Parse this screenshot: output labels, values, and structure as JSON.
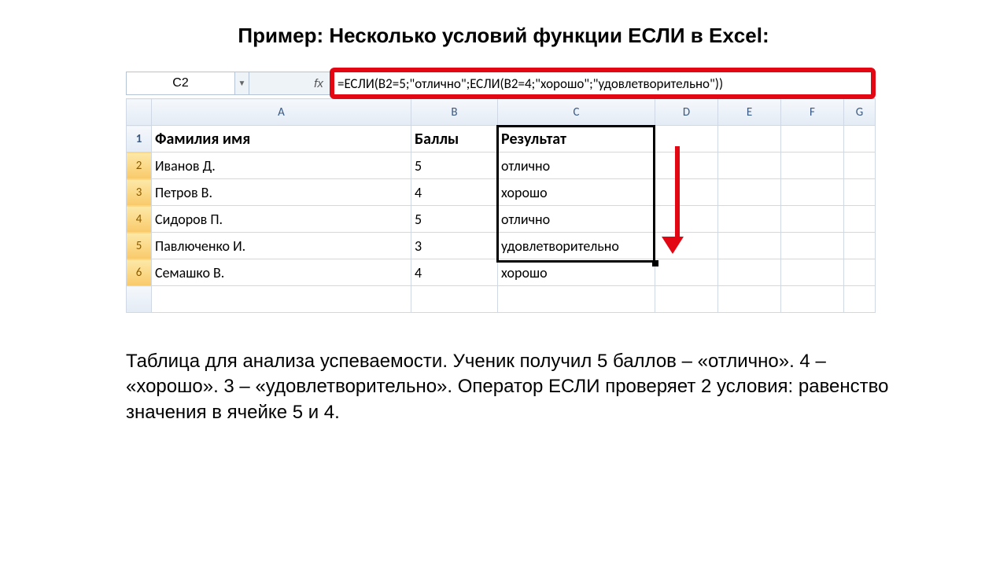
{
  "title": "Пример: Несколько условий функции ЕСЛИ в Excel:",
  "namebox": "C2",
  "fx": "fx",
  "formula": "=ЕСЛИ(B2=5;\"отлично\";ЕСЛИ(B2=4;\"хорошо\";\"удовлетворительно\"))",
  "cols": {
    "A": "A",
    "B": "B",
    "C": "C",
    "D": "D",
    "E": "E",
    "F": "F",
    "G": "G"
  },
  "rownum": {
    "r1": "1",
    "r2": "2",
    "r3": "3",
    "r4": "4",
    "r5": "5",
    "r6": "6"
  },
  "headers": {
    "A": "Фамилия имя",
    "B": "Баллы",
    "C": "Результат"
  },
  "rows": [
    {
      "name": "Иванов Д.",
      "score": "5",
      "result": "отлично"
    },
    {
      "name": "Петров В.",
      "score": "4",
      "result": "хорошо"
    },
    {
      "name": "Сидоров П.",
      "score": "5",
      "result": "отлично"
    },
    {
      "name": "Павлюченко И.",
      "score": "3",
      "result": "удовлетворительно"
    },
    {
      "name": "Семашко В.",
      "score": "4",
      "result": "хорошо"
    }
  ],
  "caption": "Таблица для анализа успеваемости. Ученик получил 5 баллов – «отлично». 4 – «хорошо». 3 – «удовлетворительно». Оператор ЕСЛИ проверяет 2 условия: равенство значения в ячейке 5 и 4."
}
